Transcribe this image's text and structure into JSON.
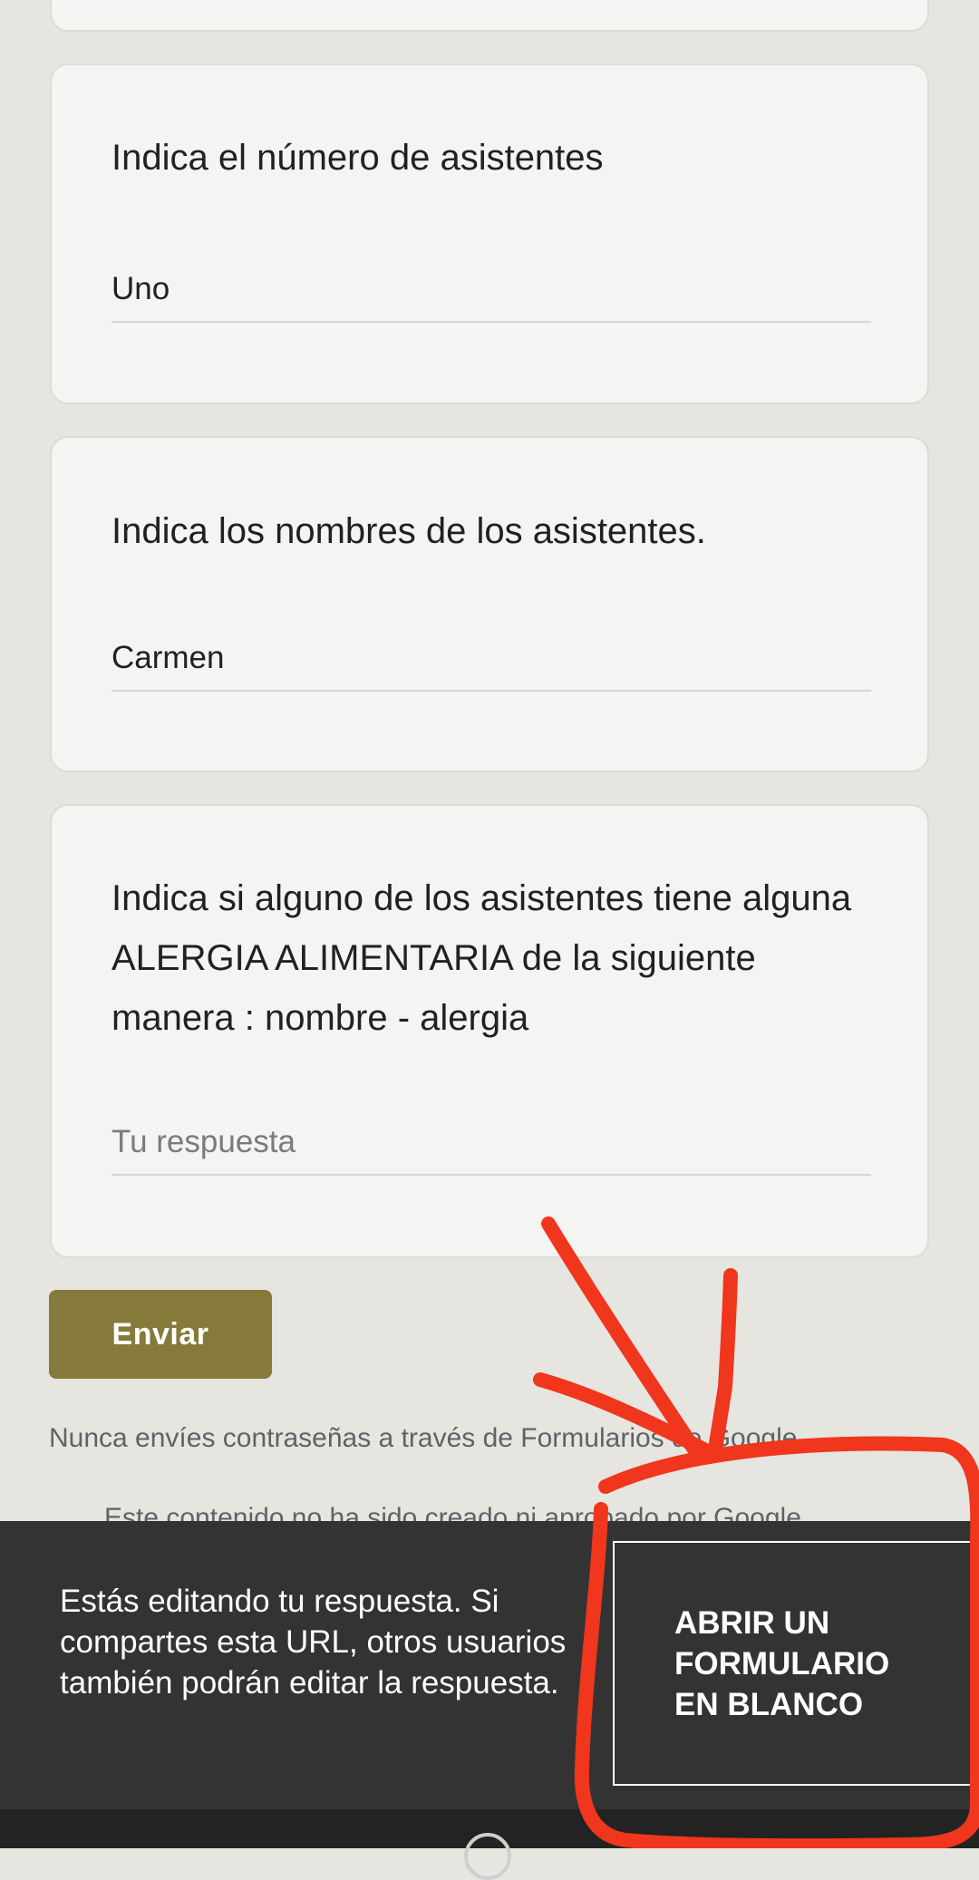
{
  "questions": [
    {
      "title": "Indica el número de asistentes",
      "answer": "Uno"
    },
    {
      "title": "Indica los nombres de los asistentes.",
      "answer": "Carmen"
    },
    {
      "title": "Indica si alguno de los asistentes tiene alguna ALERGIA ALIMENTARIA de la siguiente manera : nombre - alergia",
      "placeholder": "Tu respuesta"
    }
  ],
  "submit_label": "Enviar",
  "footer": {
    "password_warning": "Nunca envíes contraseñas a través de Formularios de Google.",
    "disclaimer": "Este contenido no ha sido creado ni aprobado por Google."
  },
  "snackbar": {
    "message": "Estás editando tu respuesta. Si compartes esta URL, otros usuarios también podrán editar la respuesta.",
    "action_label": "ABRIR UN\nFORMULARIO\nEN BLANCO"
  },
  "colors": {
    "accent": "#857a3a",
    "background": "#e6e5e0",
    "annotation": "#f0361c"
  }
}
